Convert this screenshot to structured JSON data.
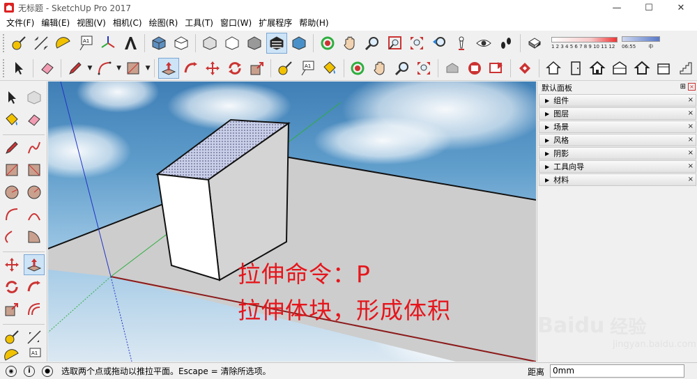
{
  "window": {
    "title": "无标题 - SketchUp Pro 2017"
  },
  "window_controls": {
    "minimize": "—",
    "maximize": "☐",
    "close": "✕"
  },
  "menu": [
    "文件(F)",
    "编辑(E)",
    "视图(V)",
    "相机(C)",
    "绘图(R)",
    "工具(T)",
    "窗口(W)",
    "扩展程序",
    "帮助(H)"
  ],
  "toolbar": {
    "text_tool_label": "A1",
    "shadow_scale": {
      "months": "1 2 3 4 5 6 7 8 9 10 11 12",
      "time": "06:55",
      "noon": "中"
    }
  },
  "left_tools": {
    "text_tool_label": "A1"
  },
  "viewport": {
    "caption_line1": "拉伸命令：P",
    "caption_line2": "拉伸体块，形成体积",
    "axis_colors": {
      "red": "#8b1a1a",
      "green": "#2fae3f",
      "blue": "#2033c8"
    }
  },
  "tray": {
    "title": "默认面板",
    "pin": "⊞",
    "close": "×",
    "panels": [
      "组件",
      "图层",
      "场景",
      "风格",
      "阴影",
      "工具向导",
      "材料"
    ],
    "watermark_logo": "Baidu",
    "watermark_cn": "经验",
    "watermark_url": "jingyan.baidu.com"
  },
  "statusbar": {
    "hint": "选取两个点或拖动以推拉平面。Escape = 清除所选项。",
    "measure_label": "距离",
    "measure_value": "0mm"
  }
}
